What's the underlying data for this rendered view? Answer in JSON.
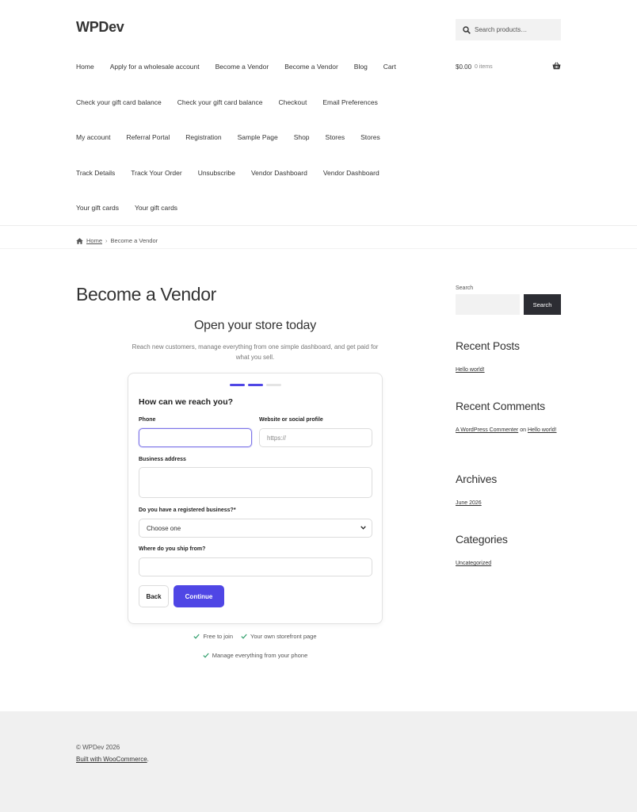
{
  "site": {
    "title": "WPDev"
  },
  "header_search": {
    "placeholder": "Search products…"
  },
  "nav": {
    "rows": [
      [
        "Home",
        "Apply for a wholesale account",
        "Become a Vendor",
        "Become a Vendor",
        "Blog",
        "Cart"
      ],
      [
        "Check your gift card balance",
        "Check your gift card balance",
        "Checkout",
        "Email Preferences"
      ],
      [
        "My account",
        "Referral Portal",
        "Registration",
        "Sample Page",
        "Shop",
        "Stores",
        "Stores"
      ],
      [
        "Track Details",
        "Track Your Order",
        "Unsubscribe",
        "Vendor Dashboard",
        "Vendor Dashboard"
      ],
      [
        "Your gift cards",
        "Your gift cards"
      ]
    ]
  },
  "cart": {
    "amount": "$0.00",
    "items": "0 items"
  },
  "breadcrumb": {
    "home": "Home",
    "current": "Become a Vendor"
  },
  "page": {
    "title": "Become a Vendor",
    "hero_title": "Open your store today",
    "hero_sub": "Reach new customers, manage everything from one simple dashboard, and get paid for what you sell."
  },
  "form": {
    "steps_total": 3,
    "steps_completed": 2,
    "heading": "How can we reach you?",
    "phone_label": "Phone",
    "phone_value": "",
    "website_label": "Website or social profile",
    "website_placeholder": "https://",
    "address_label": "Business address",
    "registered_label": "Do you have a registered business?*",
    "registered_value": "Choose one",
    "ship_label": "Where do you ship from?",
    "back_label": "Back",
    "continue_label": "Continue"
  },
  "perks": [
    "Free to join",
    "Your own storefront page",
    "Manage everything from your phone"
  ],
  "sidebar": {
    "search_label": "Search",
    "search_button": "Search",
    "recent_posts_title": "Recent Posts",
    "recent_post": "Hello world!",
    "recent_comments_title": "Recent Comments",
    "comment_author": "A WordPress Commenter",
    "comment_on": "on",
    "comment_post": "Hello world!",
    "archives_title": "Archives",
    "archive_item": "June 2026",
    "categories_title": "Categories",
    "category_item": "Uncategorized"
  },
  "footer": {
    "copyright": "© WPDev 2026",
    "built_with": "Built with WooCommerce",
    "built_end": "."
  },
  "colors": {
    "accent": "#4f46e5",
    "dark_button": "#2c2d33",
    "footer_bg": "#f0f0f0"
  }
}
